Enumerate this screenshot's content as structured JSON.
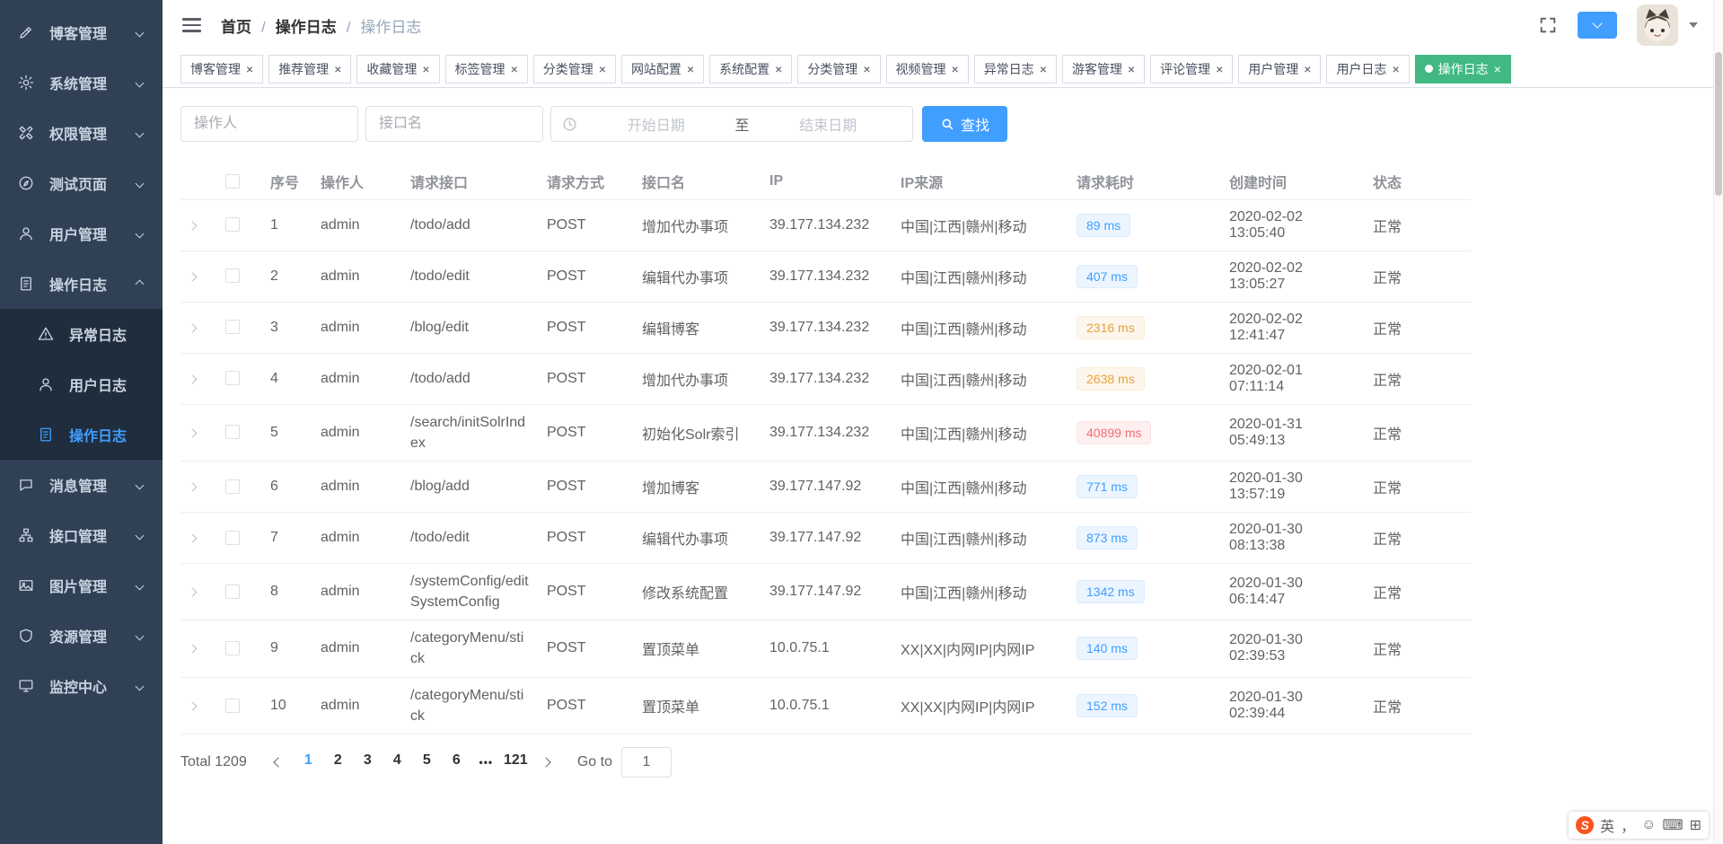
{
  "colors": {
    "accent": "#409EFF",
    "tab_active": "#42b983",
    "sidebar_bg": "#304156",
    "sidebar_sub_bg": "#1f2d3d",
    "badge_blue": "#409eff",
    "badge_orange": "#e6a23c",
    "badge_red": "#f56c6c"
  },
  "header": {
    "breadcrumb": [
      {
        "label": "首页",
        "state": "link"
      },
      {
        "label": "操作日志",
        "state": "link"
      },
      {
        "label": "操作日志",
        "state": "current"
      }
    ]
  },
  "sidebar": {
    "items": [
      {
        "label": "博客管理",
        "icon": "pencil",
        "level": "top",
        "chevron": "down",
        "state": "normal"
      },
      {
        "label": "系统管理",
        "icon": "gear",
        "level": "top",
        "chevron": "down",
        "state": "normal"
      },
      {
        "label": "权限管理",
        "icon": "tools",
        "level": "top",
        "chevron": "down",
        "state": "normal"
      },
      {
        "label": "测试页面",
        "icon": "compass",
        "level": "top",
        "chevron": "down",
        "state": "normal"
      },
      {
        "label": "用户管理",
        "icon": "user",
        "level": "top",
        "chevron": "down",
        "state": "normal"
      },
      {
        "label": "操作日志",
        "icon": "log",
        "level": "top",
        "chevron": "up",
        "state": "open"
      },
      {
        "label": "异常日志",
        "icon": "warning",
        "level": "sub",
        "chevron": "none",
        "state": "normal"
      },
      {
        "label": "用户日志",
        "icon": "user",
        "level": "sub",
        "chevron": "none",
        "state": "normal"
      },
      {
        "label": "操作日志",
        "icon": "log",
        "level": "sub",
        "chevron": "none",
        "state": "active"
      },
      {
        "label": "消息管理",
        "icon": "message",
        "level": "top",
        "chevron": "down",
        "state": "normal"
      },
      {
        "label": "接口管理",
        "icon": "sitemap",
        "level": "top",
        "chevron": "down",
        "state": "normal"
      },
      {
        "label": "图片管理",
        "icon": "image",
        "level": "top",
        "chevron": "down",
        "state": "normal"
      },
      {
        "label": "资源管理",
        "icon": "shield",
        "level": "top",
        "chevron": "down",
        "state": "normal"
      },
      {
        "label": "监控中心",
        "icon": "monitor",
        "level": "top",
        "chevron": "down",
        "state": "normal"
      }
    ]
  },
  "tabs": [
    {
      "label": "博客管理",
      "state": "normal"
    },
    {
      "label": "推荐管理",
      "state": "normal"
    },
    {
      "label": "收藏管理",
      "state": "normal"
    },
    {
      "label": "标签管理",
      "state": "normal"
    },
    {
      "label": "分类管理",
      "state": "normal"
    },
    {
      "label": "网站配置",
      "state": "normal"
    },
    {
      "label": "系统配置",
      "state": "normal"
    },
    {
      "label": "分类管理",
      "state": "normal"
    },
    {
      "label": "视频管理",
      "state": "normal"
    },
    {
      "label": "异常日志",
      "state": "normal"
    },
    {
      "label": "游客管理",
      "state": "normal"
    },
    {
      "label": "评论管理",
      "state": "normal"
    },
    {
      "label": "用户管理",
      "state": "normal"
    },
    {
      "label": "用户日志",
      "state": "normal"
    },
    {
      "label": "操作日志",
      "state": "active"
    }
  ],
  "filters": {
    "operator_placeholder": "操作人",
    "interface_placeholder": "接口名",
    "date_start_placeholder": "开始日期",
    "date_separator": "至",
    "date_end_placeholder": "结束日期",
    "search_label": "查找"
  },
  "table": {
    "columns": [
      "序号",
      "操作人",
      "请求接口",
      "请求方式",
      "接口名",
      "IP",
      "IP来源",
      "请求耗时",
      "创建时间",
      "状态"
    ],
    "rows": [
      {
        "idx": "1",
        "operator": "admin",
        "api": "/todo/add",
        "method": "POST",
        "api_name": "增加代办事项",
        "ip": "39.177.134.232",
        "ip_source": "中国|江西|赣州|移动",
        "duration": "89 ms",
        "level": "blue",
        "created": "2020-02-02 13:05:40",
        "status": "正常"
      },
      {
        "idx": "2",
        "operator": "admin",
        "api": "/todo/edit",
        "method": "POST",
        "api_name": "编辑代办事项",
        "ip": "39.177.134.232",
        "ip_source": "中国|江西|赣州|移动",
        "duration": "407 ms",
        "level": "blue",
        "created": "2020-02-02 13:05:27",
        "status": "正常"
      },
      {
        "idx": "3",
        "operator": "admin",
        "api": "/blog/edit",
        "method": "POST",
        "api_name": "编辑博客",
        "ip": "39.177.134.232",
        "ip_source": "中国|江西|赣州|移动",
        "duration": "2316 ms",
        "level": "orange",
        "created": "2020-02-02 12:41:47",
        "status": "正常"
      },
      {
        "idx": "4",
        "operator": "admin",
        "api": "/todo/add",
        "method": "POST",
        "api_name": "增加代办事项",
        "ip": "39.177.134.232",
        "ip_source": "中国|江西|赣州|移动",
        "duration": "2638 ms",
        "level": "orange",
        "created": "2020-02-01 07:11:14",
        "status": "正常"
      },
      {
        "idx": "5",
        "operator": "admin",
        "api": "/search/initSolrIndex",
        "method": "POST",
        "api_name": "初始化Solr索引",
        "ip": "39.177.134.232",
        "ip_source": "中国|江西|赣州|移动",
        "duration": "40899 ms",
        "level": "red",
        "created": "2020-01-31 05:49:13",
        "status": "正常"
      },
      {
        "idx": "6",
        "operator": "admin",
        "api": "/blog/add",
        "method": "POST",
        "api_name": "增加博客",
        "ip": "39.177.147.92",
        "ip_source": "中国|江西|赣州|移动",
        "duration": "771 ms",
        "level": "blue",
        "created": "2020-01-30 13:57:19",
        "status": "正常"
      },
      {
        "idx": "7",
        "operator": "admin",
        "api": "/todo/edit",
        "method": "POST",
        "api_name": "编辑代办事项",
        "ip": "39.177.147.92",
        "ip_source": "中国|江西|赣州|移动",
        "duration": "873 ms",
        "level": "blue",
        "created": "2020-01-30 08:13:38",
        "status": "正常"
      },
      {
        "idx": "8",
        "operator": "admin",
        "api": "/systemConfig/editSystemConfig",
        "method": "POST",
        "api_name": "修改系统配置",
        "ip": "39.177.147.92",
        "ip_source": "中国|江西|赣州|移动",
        "duration": "1342 ms",
        "level": "blue",
        "created": "2020-01-30 06:14:47",
        "status": "正常"
      },
      {
        "idx": "9",
        "operator": "admin",
        "api": "/categoryMenu/stick",
        "method": "POST",
        "api_name": "置顶菜单",
        "ip": "10.0.75.1",
        "ip_source": "XX|XX|内网IP|内网IP",
        "duration": "140 ms",
        "level": "blue",
        "created": "2020-01-30 02:39:53",
        "status": "正常"
      },
      {
        "idx": "10",
        "operator": "admin",
        "api": "/categoryMenu/stick",
        "method": "POST",
        "api_name": "置顶菜单",
        "ip": "10.0.75.1",
        "ip_source": "XX|XX|内网IP|内网IP",
        "duration": "152 ms",
        "level": "blue",
        "created": "2020-01-30 02:39:44",
        "status": "正常"
      }
    ]
  },
  "pagination": {
    "total_label": "Total 1209",
    "pages": [
      {
        "label": "1",
        "state": "active"
      },
      {
        "label": "2",
        "state": "num"
      },
      {
        "label": "3",
        "state": "num"
      },
      {
        "label": "4",
        "state": "num"
      },
      {
        "label": "5",
        "state": "num"
      },
      {
        "label": "6",
        "state": "num"
      },
      {
        "label": "•••",
        "state": "ellipsis"
      },
      {
        "label": "121",
        "state": "num"
      }
    ],
    "goto_label": "Go to",
    "goto_value": "1"
  },
  "ime": {
    "items": [
      {
        "glyph": "S",
        "name": "sogou-ime-logo",
        "style": "logo"
      },
      {
        "glyph": "英",
        "name": "ime-language-toggle",
        "style": "icon"
      },
      {
        "glyph": "，",
        "name": "ime-punctuation-toggle",
        "style": "icon"
      },
      {
        "glyph": "☺",
        "name": "ime-emoji-picker",
        "style": "icon"
      },
      {
        "glyph": "⌨",
        "name": "ime-soft-keyboard",
        "style": "icon"
      },
      {
        "glyph": "⊞",
        "name": "ime-toolbox",
        "style": "icon"
      }
    ]
  }
}
